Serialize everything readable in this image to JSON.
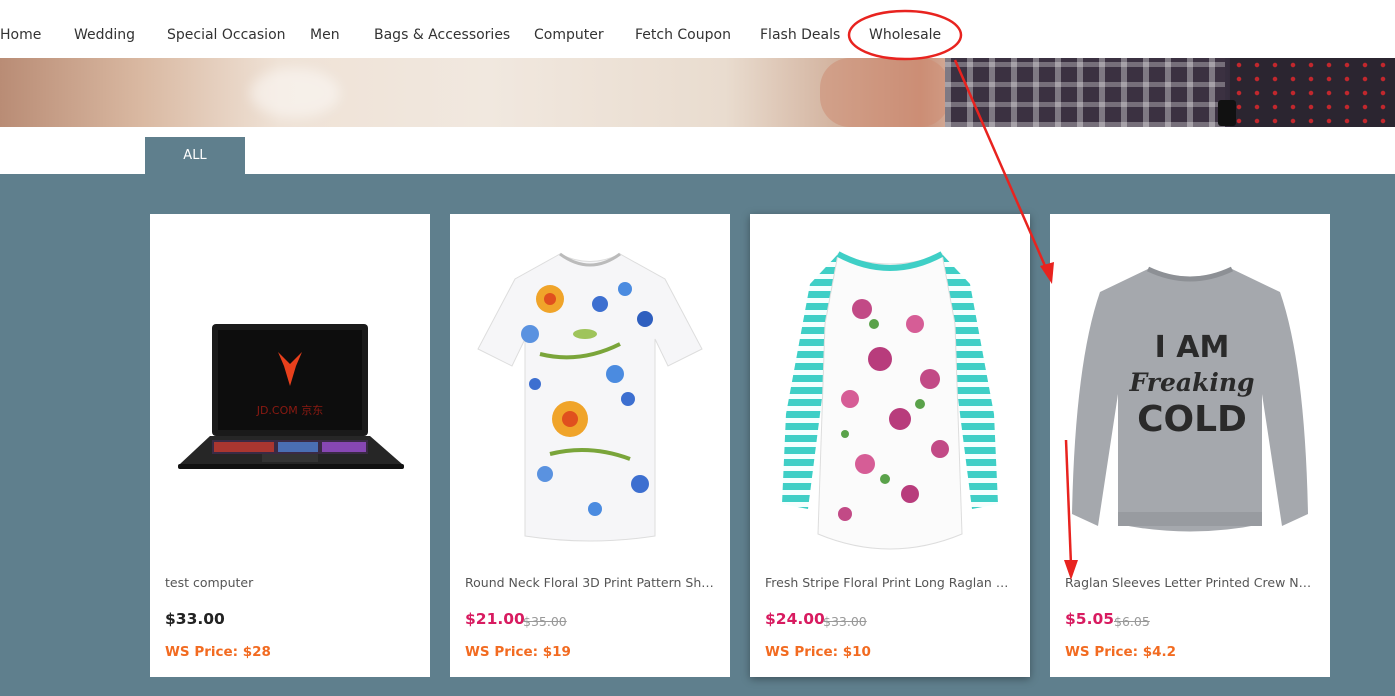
{
  "nav": {
    "items": [
      "Home",
      "Wedding",
      "Special Occasion",
      "Men",
      "Bags & Accessories",
      "Computer",
      "Fetch Coupon",
      "Flash Deals",
      "Wholesale"
    ]
  },
  "tabs": {
    "all_label": "ALL"
  },
  "products": [
    {
      "title": "test computer",
      "price": "$33.00",
      "old_price": "",
      "ws_price": "WS Price: $28",
      "image": "laptop-image"
    },
    {
      "title": "Round Neck Floral 3D Print Pattern Sho...",
      "price": "$21.00",
      "old_price": "$35.00",
      "ws_price": "WS Price: $19",
      "image": "floral-tshirt-image"
    },
    {
      "title": "Fresh Stripe Floral Print Long Raglan Sle...",
      "price": "$24.00",
      "old_price": "$33.00",
      "ws_price": "WS Price: $10",
      "image": "striped-floral-top-image"
    },
    {
      "title": "Raglan Sleeves Letter Printed Crew Nec...",
      "price": "$5.05",
      "old_price": "$6.05",
      "ws_price": "WS Price: $4.2",
      "image": "sweatshirt-image"
    }
  ],
  "sweatshirt_print": [
    "I AM",
    "Freaking",
    "COLD"
  ],
  "laptop_screen_text": "JD.COM 京东",
  "colors": {
    "accent_band": "#5f7f8d",
    "price_red": "#d81b60",
    "ws_orange": "#f26b21",
    "annotation_red": "#e8231f"
  }
}
